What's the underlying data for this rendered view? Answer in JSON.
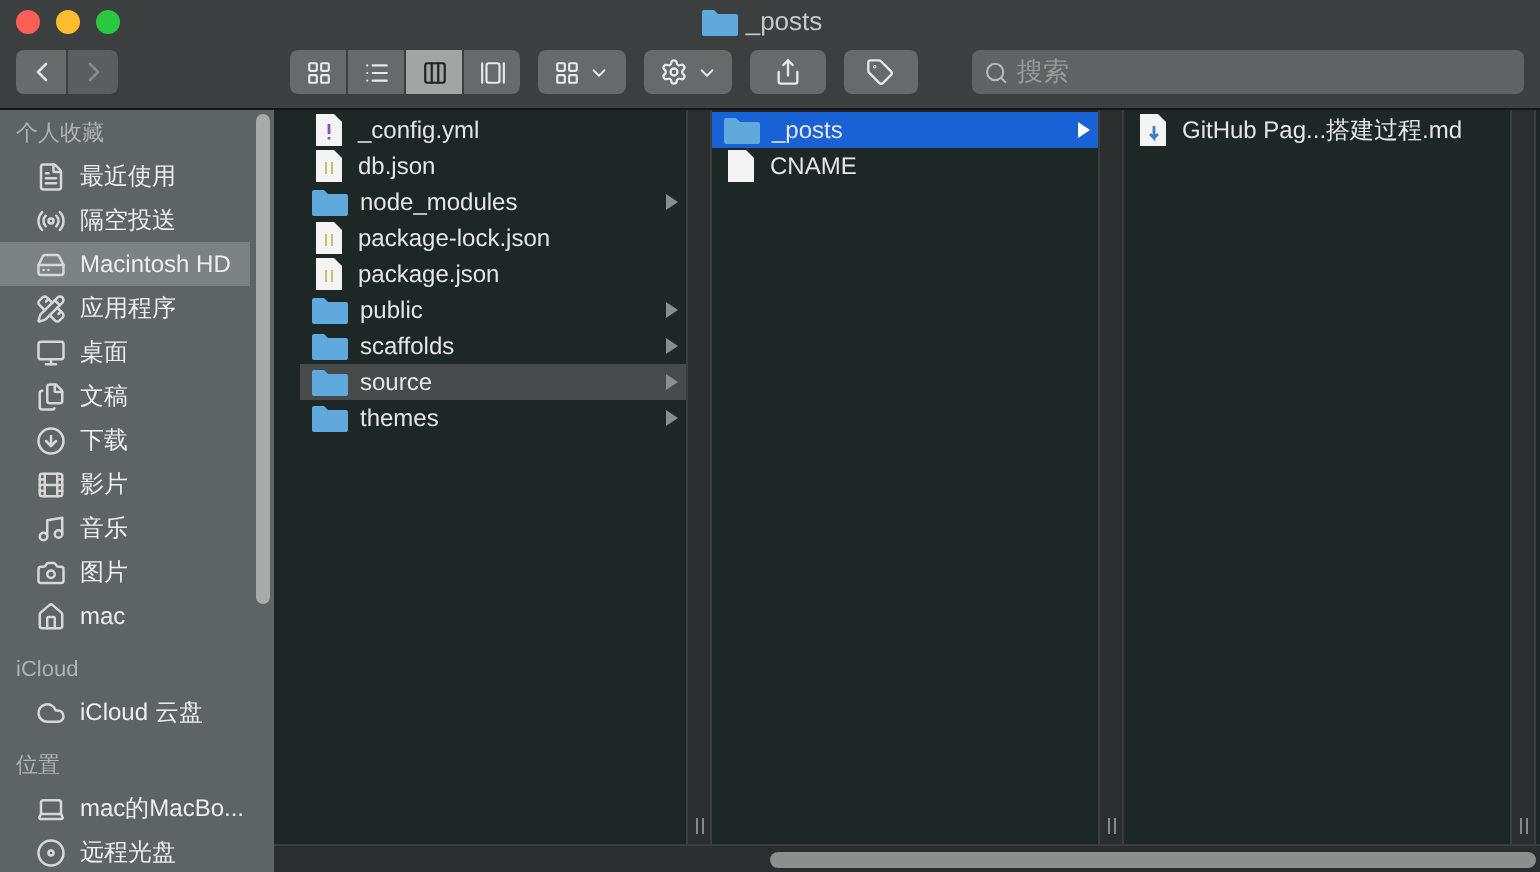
{
  "window": {
    "title": "_posts"
  },
  "toolbar": {
    "view_buttons": [
      {
        "selected": false
      },
      {
        "selected": false
      },
      {
        "selected": true
      },
      {
        "selected": false
      }
    ],
    "search": {
      "placeholder": "搜索"
    }
  },
  "sidebar": {
    "sections": [
      {
        "title": "个人收藏",
        "items": [
          {
            "label": "最近使用",
            "selected": false
          },
          {
            "label": "隔空投送",
            "selected": false
          },
          {
            "label": "Macintosh HD",
            "selected": true
          },
          {
            "label": "应用程序",
            "selected": false
          },
          {
            "label": "桌面",
            "selected": false
          },
          {
            "label": "文稿",
            "selected": false
          },
          {
            "label": "下载",
            "selected": false
          },
          {
            "label": "影片",
            "selected": false
          },
          {
            "label": "音乐",
            "selected": false
          },
          {
            "label": "图片",
            "selected": false
          },
          {
            "label": "mac",
            "selected": false
          }
        ]
      },
      {
        "title": "iCloud",
        "items": [
          {
            "label": "iCloud 云盘",
            "selected": false
          }
        ]
      },
      {
        "title": "位置",
        "items": [
          {
            "label": "mac的MacBo...",
            "selected": false
          },
          {
            "label": "远程光盘",
            "selected": false
          }
        ]
      }
    ]
  },
  "columns": [
    {
      "focused": false,
      "items": [
        {
          "name": "_config.yml",
          "kind": "yml",
          "has_children": false,
          "selected": false
        },
        {
          "name": "db.json",
          "kind": "json",
          "has_children": false,
          "selected": false
        },
        {
          "name": "node_modules",
          "kind": "folder",
          "has_children": true,
          "selected": false
        },
        {
          "name": "package-lock.json",
          "kind": "json",
          "has_children": false,
          "selected": false
        },
        {
          "name": "package.json",
          "kind": "json",
          "has_children": false,
          "selected": false
        },
        {
          "name": "public",
          "kind": "folder",
          "has_children": true,
          "selected": false
        },
        {
          "name": "scaffolds",
          "kind": "folder",
          "has_children": true,
          "selected": false
        },
        {
          "name": "source",
          "kind": "folder",
          "has_children": true,
          "selected": true
        },
        {
          "name": "themes",
          "kind": "folder",
          "has_children": true,
          "selected": false
        }
      ]
    },
    {
      "focused": true,
      "items": [
        {
          "name": "_posts",
          "kind": "folder",
          "has_children": true,
          "selected": true
        },
        {
          "name": "CNAME",
          "kind": "file",
          "has_children": false,
          "selected": false
        }
      ]
    },
    {
      "items": [
        {
          "name": "GitHub Pag...搭建过程.md",
          "kind": "md",
          "has_children": false,
          "selected": false
        }
      ]
    }
  ]
}
